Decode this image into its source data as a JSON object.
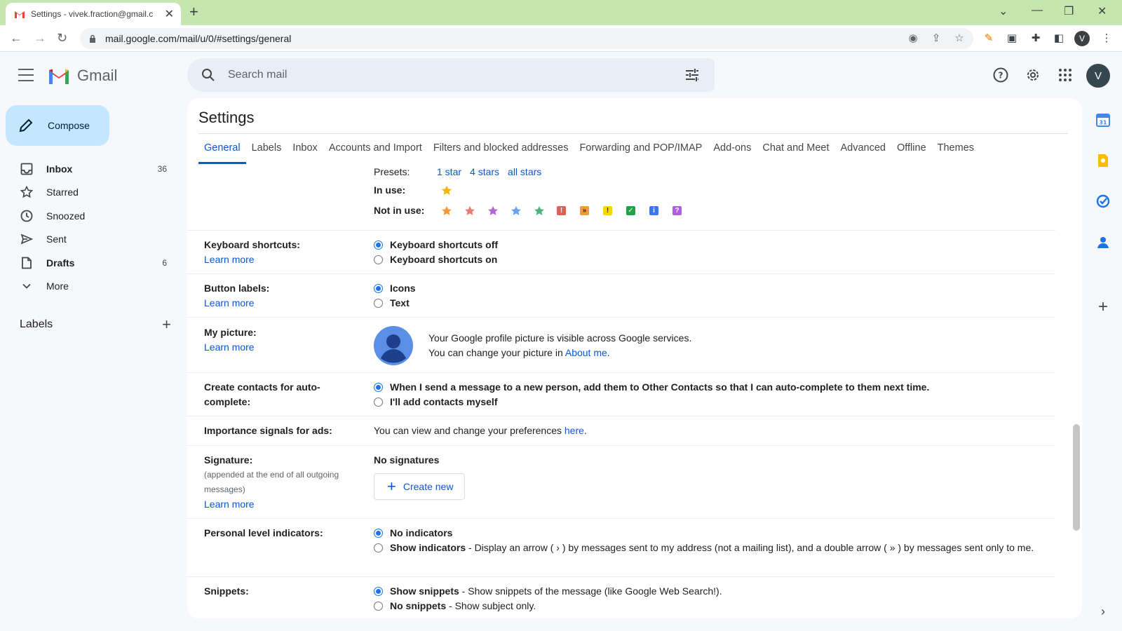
{
  "browser": {
    "tab_title": "Settings - vivek.fraction@gmail.c",
    "url": "mail.google.com/mail/u/0/#settings/general",
    "profile_initial": "V"
  },
  "app": {
    "name": "Gmail",
    "search_placeholder": "Search mail",
    "avatar_initial": "V"
  },
  "sidebar": {
    "compose_label": "Compose",
    "items": [
      {
        "label": "Inbox",
        "count": "36"
      },
      {
        "label": "Starred",
        "count": ""
      },
      {
        "label": "Snoozed",
        "count": ""
      },
      {
        "label": "Sent",
        "count": ""
      },
      {
        "label": "Drafts",
        "count": "6"
      },
      {
        "label": "More",
        "count": ""
      }
    ],
    "labels_title": "Labels"
  },
  "settings": {
    "title": "Settings",
    "tabs": [
      "General",
      "Labels",
      "Inbox",
      "Accounts and Import",
      "Filters and blocked addresses",
      "Forwarding and POP/IMAP",
      "Add-ons",
      "Chat and Meet",
      "Advanced",
      "Offline",
      "Themes"
    ],
    "stars": {
      "presets_label": "Presets:",
      "presets": [
        "1 star",
        "4 stars",
        "all stars"
      ],
      "in_use_label": "In use:",
      "not_in_use_label": "Not in use:"
    },
    "keyboard": {
      "label": "Keyboard shortcuts:",
      "learn_more": "Learn more",
      "opt_off": "Keyboard shortcuts off",
      "opt_on": "Keyboard shortcuts on"
    },
    "button_labels": {
      "label": "Button labels:",
      "learn_more": "Learn more",
      "opt_icons": "Icons",
      "opt_text": "Text"
    },
    "picture": {
      "label": "My picture:",
      "learn_more": "Learn more",
      "line1": "Your Google profile picture is visible across Google services.",
      "line2_prefix": "You can change your picture in ",
      "line2_link": "About me",
      "line2_suffix": "."
    },
    "contacts": {
      "label": "Create contacts for auto-complete:",
      "opt_auto": "When I send a message to a new person, add them to Other Contacts so that I can auto-complete to them next time.",
      "opt_manual": "I'll add contacts myself"
    },
    "ads": {
      "label": "Importance signals for ads:",
      "text_prefix": "You can view and change your preferences ",
      "link": "here",
      "text_suffix": "."
    },
    "signature": {
      "label": "Signature:",
      "sub": "(appended at the end of all outgoing messages)",
      "learn_more": "Learn more",
      "no_sig": "No signatures",
      "create_new": "Create new"
    },
    "indicators": {
      "label": "Personal level indicators:",
      "opt_none": "No indicators",
      "opt_show": "Show indicators",
      "opt_show_desc": " - Display an arrow ( › ) by messages sent to my address (not a mailing list), and a double arrow ( » ) by messages sent only to me."
    },
    "snippets": {
      "label": "Snippets:",
      "opt_show": "Show snippets",
      "opt_show_desc": " - Show snippets of the message (like Google Web Search!).",
      "opt_none": "No snippets",
      "opt_none_desc": " - Show subject only."
    }
  },
  "colors": {
    "accent": "#0b57d0",
    "compose_bg": "#c2e7ff",
    "titlebar": "#c6e6b0"
  }
}
